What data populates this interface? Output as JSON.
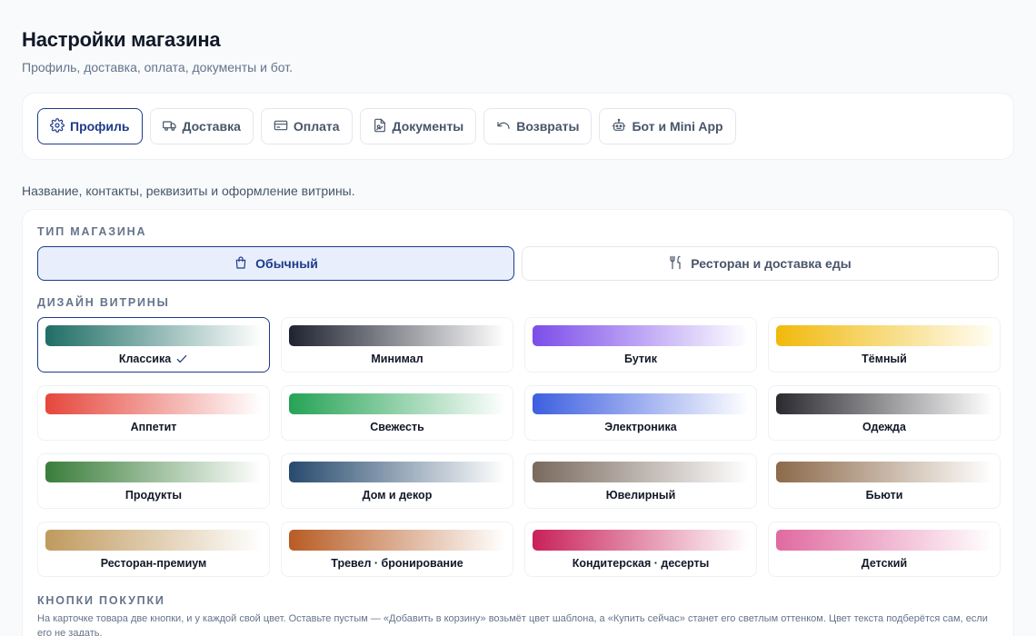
{
  "header": {
    "title": "Настройки магазина",
    "subtitle": "Профиль, доставка, оплата, документы и бот."
  },
  "tabs": [
    {
      "label": "Профиль",
      "icon": "gear-icon",
      "active": true
    },
    {
      "label": "Доставка",
      "icon": "truck-icon",
      "active": false
    },
    {
      "label": "Оплата",
      "icon": "credit-card-icon",
      "active": false
    },
    {
      "label": "Документы",
      "icon": "document-icon",
      "active": false
    },
    {
      "label": "Возвраты",
      "icon": "undo-icon",
      "active": false
    },
    {
      "label": "Бот и Mini App",
      "icon": "bot-icon",
      "active": false
    }
  ],
  "section": {
    "description": "Название, контакты, реквизиты и оформление витрины."
  },
  "store_type": {
    "label": "ТИП МАГАЗИНА",
    "options": [
      {
        "label": "Обычный",
        "icon": "shopping-bag-icon",
        "active": true
      },
      {
        "label": "Ресторан и доставка еды",
        "icon": "utensils-icon",
        "active": false
      }
    ]
  },
  "design": {
    "label": "ДИЗАЙН ВИТРИНЫ",
    "themes": [
      {
        "name": "Классика",
        "from": "#1f6e66",
        "to": "#ffffff",
        "active": true
      },
      {
        "name": "Минимал",
        "from": "#1f2230",
        "to": "#ffffff",
        "active": false
      },
      {
        "name": "Бутик",
        "from": "#7c4dea",
        "to": "#ffffff",
        "active": false
      },
      {
        "name": "Тёмный",
        "from": "#f0b90b",
        "to": "#fffdf3",
        "active": false
      },
      {
        "name": "Аппетит",
        "from": "#e5473c",
        "to": "#ffffff",
        "active": false
      },
      {
        "name": "Свежесть",
        "from": "#25a355",
        "to": "#ffffff",
        "active": false
      },
      {
        "name": "Электроника",
        "from": "#3d5fe0",
        "to": "#ffffff",
        "active": false
      },
      {
        "name": "Одежда",
        "from": "#2a2a30",
        "to": "#ffffff",
        "active": false
      },
      {
        "name": "Продукты",
        "from": "#3a7d3a",
        "to": "#ffffff",
        "active": false
      },
      {
        "name": "Дом и декор",
        "from": "#274a6e",
        "to": "#ffffff",
        "active": false
      },
      {
        "name": "Ювелирный",
        "from": "#7a6a5e",
        "to": "#ffffff",
        "active": false
      },
      {
        "name": "Бьюти",
        "from": "#8c6a4a",
        "to": "#ffffff",
        "active": false
      },
      {
        "name": "Ресторан-премиум",
        "from": "#c09a5e",
        "to": "#ffffff",
        "active": false
      },
      {
        "name": "Тревел · бронирование",
        "from": "#b85c24",
        "to": "#ffffff",
        "active": false
      },
      {
        "name": "Кондитерская · десерты",
        "from": "#c8215a",
        "to": "#ffffff",
        "active": false
      },
      {
        "name": "Детский",
        "from": "#e06aa0",
        "to": "#ffffff",
        "active": false
      }
    ]
  },
  "buy_buttons": {
    "label": "КНОПКИ ПОКУПКИ",
    "hint": "На карточке товара две кнопки, и у каждой свой цвет. Оставьте пустым — «Добавить в корзину» возьмёт цвет шаблона, а «Купить сейчас» станет его светлым оттенком. Цвет текста подберётся сам, если его не задать."
  },
  "colors": {
    "accent": "#1e3a8a",
    "accent_bg": "#e8eefc"
  }
}
